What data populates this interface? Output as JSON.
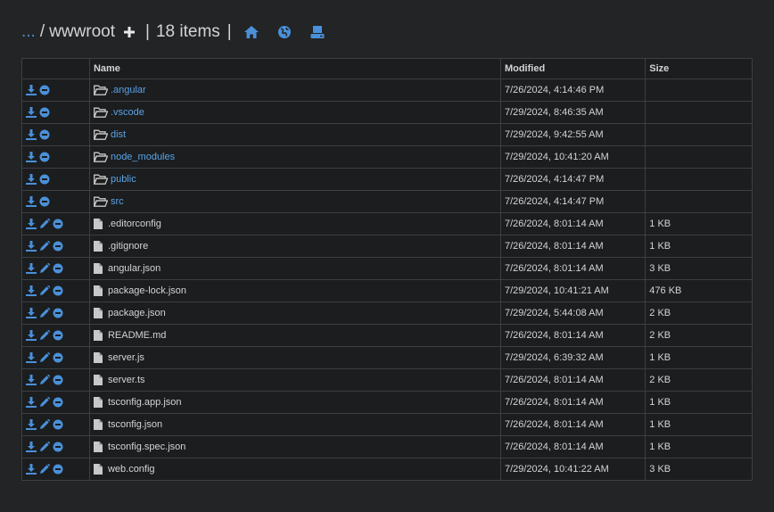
{
  "breadcrumb": {
    "parent": "...",
    "separator": "/",
    "current": "wwwroot"
  },
  "item_count": "18 items",
  "header_icons": [
    "plus-icon",
    "home-icon",
    "globe-icon",
    "drive-icon"
  ],
  "colors": {
    "accent": "#4a90d9",
    "background": "#222426",
    "table_bg": "#1b1d1f"
  },
  "table": {
    "columns": [
      "",
      "Name",
      "Modified",
      "Size"
    ],
    "rows": [
      {
        "type": "folder",
        "name": ".angular",
        "modified": "7/26/2024, 4:14:46 PM",
        "size": ""
      },
      {
        "type": "folder",
        "name": ".vscode",
        "modified": "7/29/2024, 8:46:35 AM",
        "size": ""
      },
      {
        "type": "folder",
        "name": "dist",
        "modified": "7/29/2024, 9:42:55 AM",
        "size": ""
      },
      {
        "type": "folder",
        "name": "node_modules",
        "modified": "7/29/2024, 10:41:20 AM",
        "size": ""
      },
      {
        "type": "folder",
        "name": "public",
        "modified": "7/26/2024, 4:14:47 PM",
        "size": ""
      },
      {
        "type": "folder",
        "name": "src",
        "modified": "7/26/2024, 4:14:47 PM",
        "size": ""
      },
      {
        "type": "file",
        "name": ".editorconfig",
        "modified": "7/26/2024, 8:01:14 AM",
        "size": "1 KB"
      },
      {
        "type": "file",
        "name": ".gitignore",
        "modified": "7/26/2024, 8:01:14 AM",
        "size": "1 KB"
      },
      {
        "type": "file",
        "name": "angular.json",
        "modified": "7/26/2024, 8:01:14 AM",
        "size": "3 KB"
      },
      {
        "type": "file",
        "name": "package-lock.json",
        "modified": "7/29/2024, 10:41:21 AM",
        "size": "476 KB"
      },
      {
        "type": "file",
        "name": "package.json",
        "modified": "7/29/2024, 5:44:08 AM",
        "size": "2 KB"
      },
      {
        "type": "file",
        "name": "README.md",
        "modified": "7/26/2024, 8:01:14 AM",
        "size": "2 KB"
      },
      {
        "type": "file",
        "name": "server.js",
        "modified": "7/29/2024, 6:39:32 AM",
        "size": "1 KB"
      },
      {
        "type": "file",
        "name": "server.ts",
        "modified": "7/26/2024, 8:01:14 AM",
        "size": "2 KB"
      },
      {
        "type": "file",
        "name": "tsconfig.app.json",
        "modified": "7/26/2024, 8:01:14 AM",
        "size": "1 KB"
      },
      {
        "type": "file",
        "name": "tsconfig.json",
        "modified": "7/26/2024, 8:01:14 AM",
        "size": "1 KB"
      },
      {
        "type": "file",
        "name": "tsconfig.spec.json",
        "modified": "7/26/2024, 8:01:14 AM",
        "size": "1 KB"
      },
      {
        "type": "file",
        "name": "web.config",
        "modified": "7/29/2024, 10:41:22 AM",
        "size": "3 KB"
      }
    ]
  }
}
